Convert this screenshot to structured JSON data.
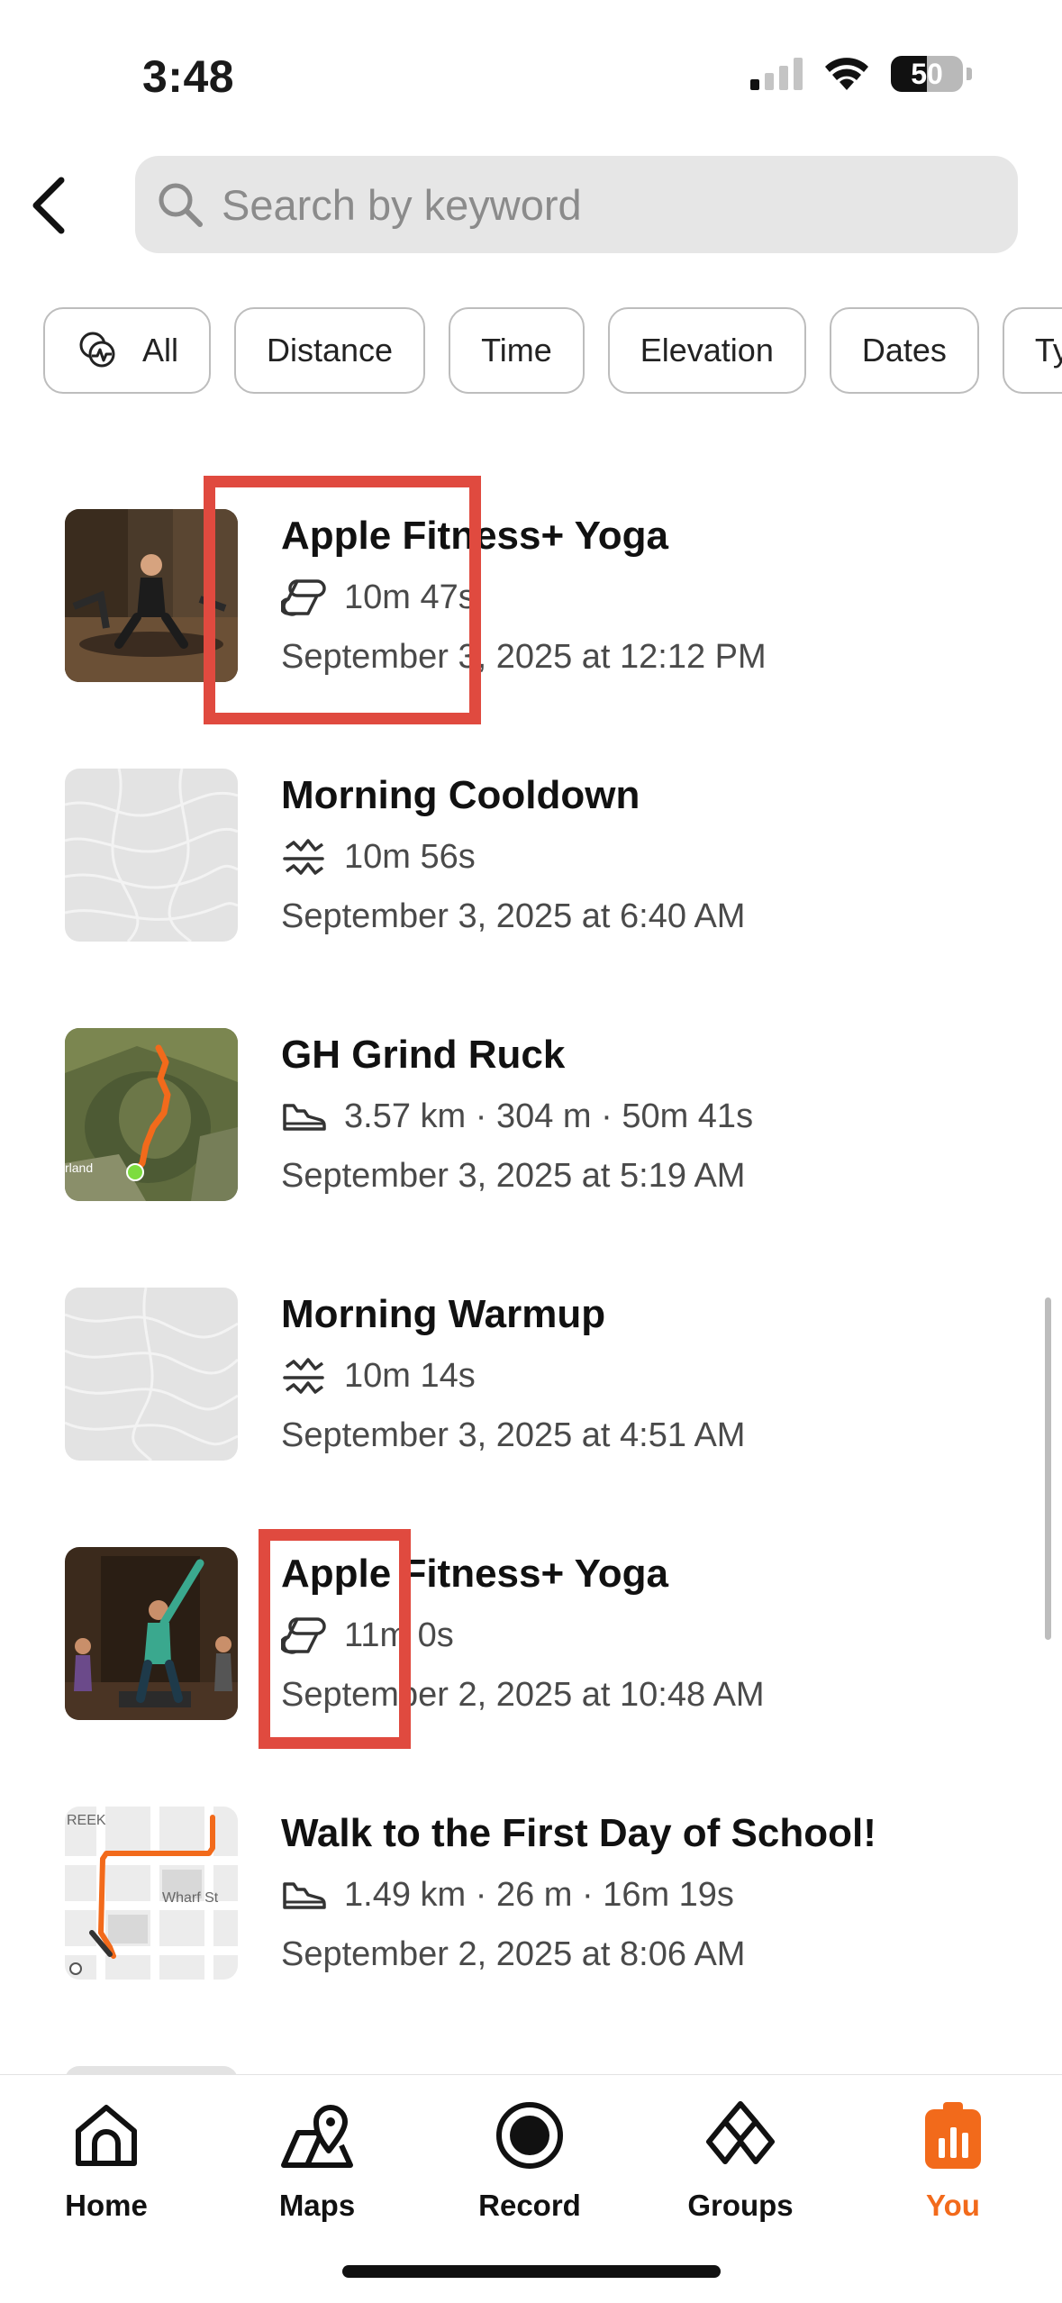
{
  "status_bar": {
    "time": "3:48",
    "battery_level": "50",
    "battery_fraction": 0.5
  },
  "search": {
    "placeholder": "Search by keyword"
  },
  "filters": {
    "chips": [
      {
        "label": "All",
        "icon": "activity-types-icon"
      },
      {
        "label": "Distance"
      },
      {
        "label": "Time"
      },
      {
        "label": "Elevation"
      },
      {
        "label": "Dates"
      },
      {
        "label": "Type"
      }
    ]
  },
  "activities": [
    {
      "title": "Apple Fitness+ Yoga",
      "type_icon": "yoga-mat-icon",
      "stats": "10m 47s",
      "date": "September 3, 2025 at 12:12 PM",
      "thumbnail": "yoga-photo"
    },
    {
      "title": "Morning Cooldown",
      "type_icon": "workout-icon",
      "stats": "10m 56s",
      "date": "September 3, 2025 at 6:40 AM",
      "thumbnail": "blank-topo-map"
    },
    {
      "title": "GH Grind Ruck",
      "type_icon": "shoe-icon",
      "stats": "3.57 km · 304 m · 50m 41s",
      "date": "September 3, 2025 at 5:19 AM",
      "thumbnail": "satellite-route-map",
      "map_label": "rland"
    },
    {
      "title": "Morning Warmup",
      "type_icon": "workout-icon",
      "stats": "10m 14s",
      "date": "September 3, 2025 at 4:51 AM",
      "thumbnail": "blank-topo-map"
    },
    {
      "title": "Apple Fitness+ Yoga",
      "type_icon": "yoga-mat-icon",
      "stats": "11m 0s",
      "date": "September 2, 2025 at 10:48 AM",
      "thumbnail": "yoga-photo"
    },
    {
      "title": "Walk to the First Day of School!",
      "type_icon": "shoe-icon",
      "stats": "1.49 km · 26 m · 16m 19s",
      "date": "September 2, 2025 at 8:06 AM",
      "thumbnail": "street-route-map",
      "map_labels": [
        "REEK",
        "Wharf St"
      ]
    }
  ],
  "nav": {
    "items": [
      {
        "label": "Home",
        "icon": "home-icon"
      },
      {
        "label": "Maps",
        "icon": "maps-icon"
      },
      {
        "label": "Record",
        "icon": "record-icon"
      },
      {
        "label": "Groups",
        "icon": "groups-icon"
      },
      {
        "label": "You",
        "icon": "you-icon",
        "active": true
      }
    ]
  },
  "colors": {
    "accent": "#f26a1b",
    "highlight": "#e04a3f",
    "route": "#f26a1b",
    "chip_border": "#bdbdbd"
  }
}
